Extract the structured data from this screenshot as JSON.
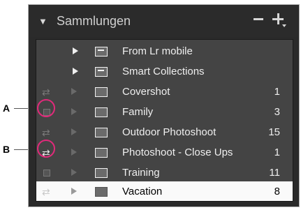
{
  "panel": {
    "title": "Sammlungen",
    "collapse_glyph": "▼",
    "remove_glyph": "minus-icon",
    "add_glyph": "plus-icon"
  },
  "callouts": {
    "a": "A",
    "b": "B"
  },
  "rows": [
    {
      "label": "From Lr mobile",
      "count": "",
      "kind": "set",
      "left_icon": "none"
    },
    {
      "label": "Smart Collections",
      "count": "",
      "kind": "set",
      "left_icon": "none"
    },
    {
      "label": "Covershot",
      "count": "1",
      "kind": "collection",
      "left_icon": "sync-icon"
    },
    {
      "label": "Family",
      "count": "3",
      "kind": "collection",
      "left_icon": "checkbox-icon"
    },
    {
      "label": "Outdoor Photoshoot",
      "count": "15",
      "kind": "collection",
      "left_icon": "sync-icon"
    },
    {
      "label": "Photoshoot - Close Ups",
      "count": "1",
      "kind": "collection",
      "left_icon": "sync-icon"
    },
    {
      "label": "Training",
      "count": "11",
      "kind": "collection",
      "left_icon": "checkbox-icon"
    },
    {
      "label": "Vacation",
      "count": "8",
      "kind": "collection",
      "left_icon": "sync-icon",
      "selected": true
    }
  ],
  "colors": {
    "highlight": "#e02a7a",
    "panel_bg": "#2a2a2a",
    "list_bg": "#444444",
    "selected_bg": "#fafafa"
  }
}
